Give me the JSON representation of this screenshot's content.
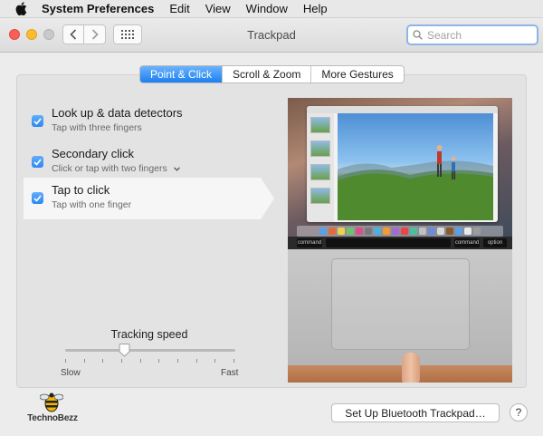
{
  "menubar": {
    "app_name": "System Preferences",
    "items": [
      "Edit",
      "View",
      "Window",
      "Help"
    ]
  },
  "window": {
    "title": "Trackpad",
    "search_placeholder": "Search"
  },
  "tabs": [
    {
      "label": "Point & Click",
      "active": true
    },
    {
      "label": "Scroll & Zoom",
      "active": false
    },
    {
      "label": "More Gestures",
      "active": false
    }
  ],
  "options": [
    {
      "title": "Look up & data detectors",
      "subtitle": "Tap with three fingers",
      "checked": true
    },
    {
      "title": "Secondary click",
      "subtitle": "Click or tap with two fingers",
      "checked": true
    },
    {
      "title": "Tap to click",
      "subtitle": "Tap with one finger",
      "checked": true
    }
  ],
  "tracking": {
    "label": "Tracking speed",
    "min_label": "Slow",
    "max_label": "Fast",
    "value_fraction": 0.35
  },
  "preview_keys": {
    "left": "command",
    "right": "command",
    "far_right": "option"
  },
  "footer": {
    "setup_button": "Set Up Bluetooth Trackpad…",
    "help_button": "?",
    "logo_text": "TechnoBezz"
  },
  "colors": {
    "accent": "#1b7ff2",
    "checkbox": "#2d86f3"
  }
}
